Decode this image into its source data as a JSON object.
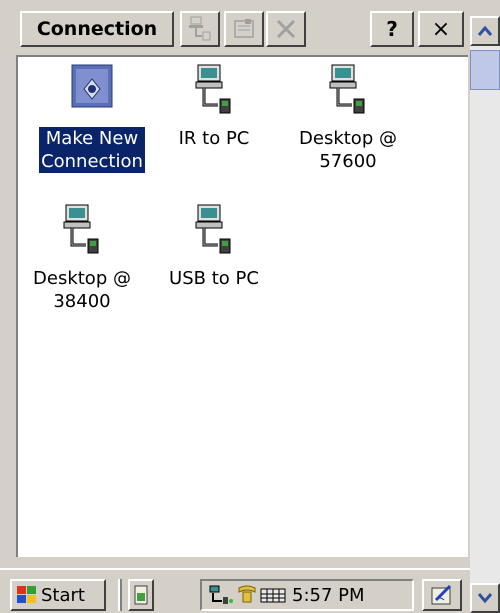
{
  "toolbar": {
    "title": "Connection",
    "help_label": "?",
    "close_label": "×"
  },
  "items": [
    {
      "label1": "Make New",
      "label2": "Connection",
      "icon": "make-new-connection-icon",
      "selected": true
    },
    {
      "label1": "IR to PC",
      "label2": "",
      "icon": "computer-connection-icon"
    },
    {
      "label1": "Desktop @",
      "label2": "57600",
      "icon": "computer-connection-icon"
    },
    {
      "label1": "Desktop @",
      "label2": "38400",
      "icon": "computer-connection-icon"
    },
    {
      "label1": "USB to PC",
      "label2": "",
      "icon": "computer-connection-icon"
    }
  ],
  "taskbar": {
    "start_label": "Start",
    "clock": "5:57 PM"
  },
  "colors": {
    "selection": "#0a246a",
    "chrome": "#d4d0c8"
  }
}
